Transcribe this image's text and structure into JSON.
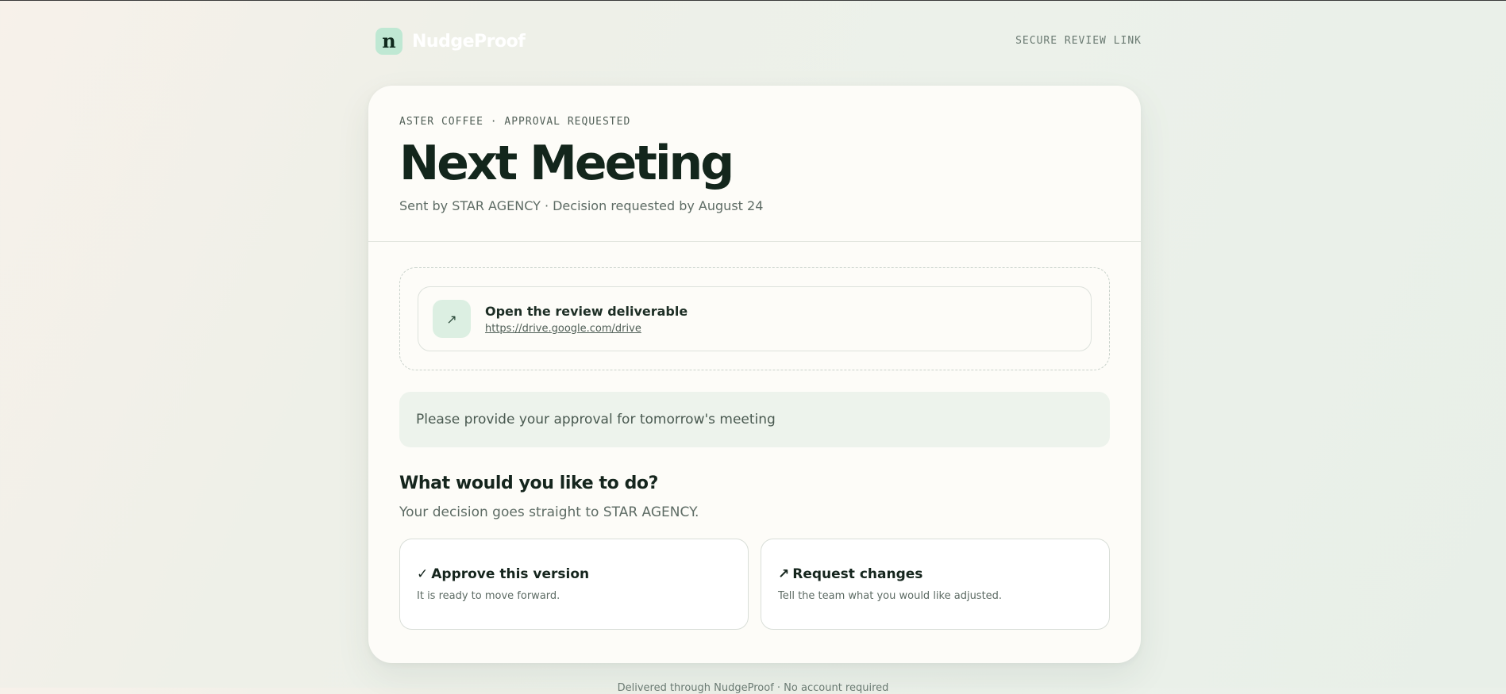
{
  "header": {
    "brand_mark": "n",
    "brand_name": "NudgeProof",
    "secure_link": "SECURE REVIEW LINK"
  },
  "card": {
    "eyebrow": "ASTER COFFEE · APPROVAL REQUESTED",
    "title": "Next Meeting",
    "subtitle": "Sent by STAR AGENCY · Decision requested by August 24",
    "deliverable": {
      "icon": "arrow-up-right-icon",
      "icon_glyph": "↗",
      "title": "Open the review deliverable",
      "url": "https://drive.google.com/drive"
    },
    "note": "Please provide your approval for tomorrow's meeting",
    "question": "What would you like to do?",
    "question_sub": "Your decision goes straight to STAR AGENCY.",
    "actions": [
      {
        "icon": "check-icon",
        "icon_glyph": "✓",
        "title": "Approve this version",
        "desc": "It is ready to move forward."
      },
      {
        "icon": "arrow-up-right-icon",
        "icon_glyph": "↗",
        "title": "Request changes",
        "desc": "Tell the team what you would like adjusted."
      }
    ]
  },
  "footer": {
    "text": "Delivered through NudgeProof · No account required"
  },
  "colors": {
    "brand_mark_bg": "#bfe8d3",
    "card_bg": "#fdfcf8",
    "note_bg": "#edf3ec",
    "text_dark": "#13261c"
  }
}
